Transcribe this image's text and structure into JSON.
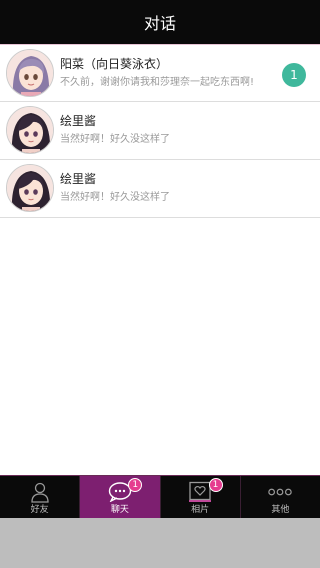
{
  "header": {
    "title": "对话"
  },
  "chats": [
    {
      "name": "阳菜（向日葵泳衣）",
      "preview": "不久前，谢谢你请我和莎理奈一起吃东西啊!",
      "unread": "1",
      "avatar": "avatar-hina-icon"
    },
    {
      "name": "绘里酱",
      "preview": "当然好啊！好久没这样了",
      "avatar": "avatar-eri-icon"
    },
    {
      "name": "绘里酱",
      "preview": "当然好啊！好久没这样了",
      "avatar": "avatar-eri-icon"
    }
  ],
  "tabbar": {
    "tabs": [
      {
        "label": "好友",
        "icon": "person-icon",
        "active": false
      },
      {
        "label": "聊天",
        "icon": "chat-bubble-icon",
        "active": true,
        "badge": "1"
      },
      {
        "label": "相片",
        "icon": "photo-heart-icon",
        "active": false,
        "badge": "1"
      },
      {
        "label": "其他",
        "icon": "more-dots-icon",
        "active": false
      }
    ]
  },
  "colors": {
    "header_bg": "#0a0a0a",
    "active_tab": "#7d1f70",
    "unread_badge": "#3fb89c",
    "tab_badge": "#e53c8f"
  }
}
